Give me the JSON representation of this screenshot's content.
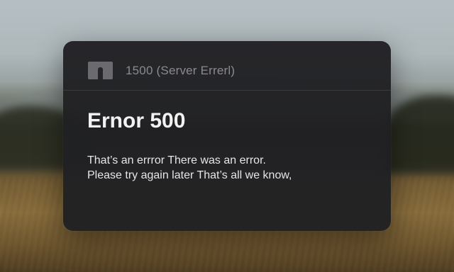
{
  "dialog": {
    "header": {
      "icon": "server-icon",
      "title": "1500 (Server Errerl)"
    },
    "heading": "Ernor 500",
    "message_lines": [
      "That’s an errror There was an error.",
      "Please try again later That’s all we know,"
    ]
  },
  "colors": {
    "dialog_background": "#202023",
    "heading_text": "#f2f2f2",
    "body_text": "#e6e6e6",
    "muted_text": "#8a8a8f",
    "icon": "#6b6b6f"
  }
}
